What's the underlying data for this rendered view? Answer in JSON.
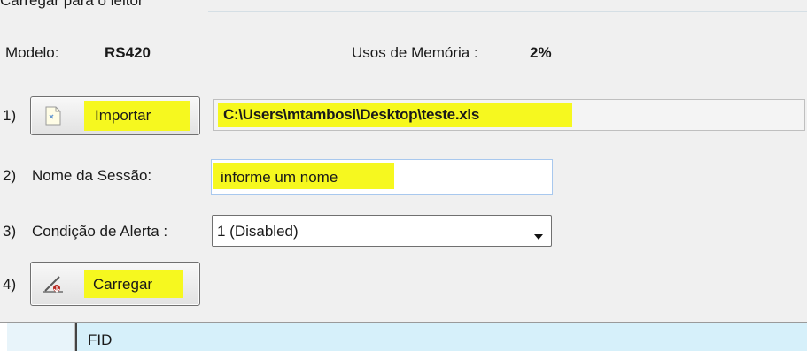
{
  "group_title": "Carregar para o leitor",
  "modelo": {
    "label": "Modelo:",
    "value": "RS420"
  },
  "memoria": {
    "label": "Usos de Memória :",
    "value": "2%"
  },
  "step1": {
    "num": "1)",
    "button_label": "Importar",
    "path_value": "C:\\Users\\mtambosi\\Desktop\\teste.xls"
  },
  "step2": {
    "num": "2)",
    "label": "Nome da Sessão:",
    "input_value": "informe um nome"
  },
  "step3": {
    "num": "3)",
    "label": "Condição de Alerta :",
    "selected": "1 (Disabled)"
  },
  "step4": {
    "num": "4)",
    "button_label": "Carregar"
  },
  "grid": {
    "column_header": "FID"
  },
  "colors": {
    "highlight": "#f6f81f",
    "grid_header": "#d6f0fa",
    "textbox_blue_border": "#7eb4ea"
  },
  "icons": {
    "import": "document-icon",
    "load": "pen-arrow-icon",
    "dropdown": "triangle-down-icon"
  }
}
